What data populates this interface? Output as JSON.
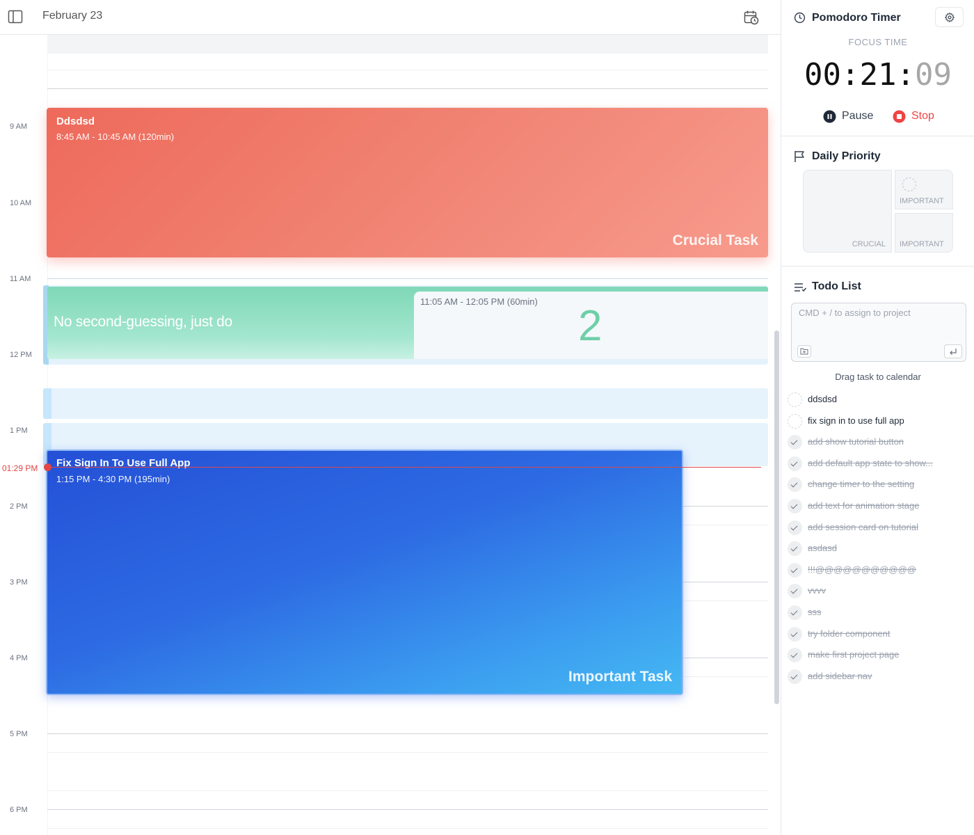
{
  "header": {
    "date": "February 23"
  },
  "calendar": {
    "hours": [
      "9 AM",
      "10 AM",
      "11 AM",
      "12 PM",
      "1 PM",
      "2 PM",
      "3 PM",
      "4 PM",
      "5 PM",
      "6 PM"
    ],
    "current_time": "01:29 PM",
    "events": {
      "red": {
        "title": "Ddsdsd",
        "time": "8:45 AM - 10:45 AM (120min)",
        "tag": "Crucial Task",
        "color": "#f07f70"
      },
      "green": {
        "text": "No second-guessing, just do",
        "time": "11:05 AM - 12:05 PM (60min)",
        "count": "2",
        "color": "#8ddfc2"
      },
      "blue": {
        "title": "Fix Sign In To Use Full App",
        "time": "1:15 PM - 4:30 PM (195min)",
        "tag": "Important Task",
        "color": "#2d6be3"
      }
    }
  },
  "pomodoro": {
    "title": "Pomodoro Timer",
    "mode": "FOCUS TIME",
    "hours": "00",
    "minutes": "21",
    "seconds": "09",
    "pause_label": "Pause",
    "stop_label": "Stop"
  },
  "priority": {
    "title": "Daily Priority",
    "crucial_label": "CRUCIAL",
    "important_label_1": "IMPORTANT",
    "important_label_2": "IMPORTANT"
  },
  "todo": {
    "title": "Todo List",
    "placeholder": "CMD + / to assign to project",
    "drag_hint": "Drag task to calendar",
    "items": [
      {
        "text": "ddsdsd",
        "done": false
      },
      {
        "text": "fix sign in to use full app",
        "done": false
      },
      {
        "text": "add show tutorial button",
        "done": true
      },
      {
        "text": "add default app state to show...",
        "done": true
      },
      {
        "text": "change timer to the setting",
        "done": true
      },
      {
        "text": "add text for animation stage",
        "done": true
      },
      {
        "text": "add session card on tutorial",
        "done": true
      },
      {
        "text": "asdasd",
        "done": true
      },
      {
        "text": "!!!@@@@@@@@@@@",
        "done": true
      },
      {
        "text": "vvvv",
        "done": true
      },
      {
        "text": "sss",
        "done": true
      },
      {
        "text": "try folder component",
        "done": true
      },
      {
        "text": "make first project page",
        "done": true
      },
      {
        "text": "add sidebar nav",
        "done": true
      }
    ]
  }
}
